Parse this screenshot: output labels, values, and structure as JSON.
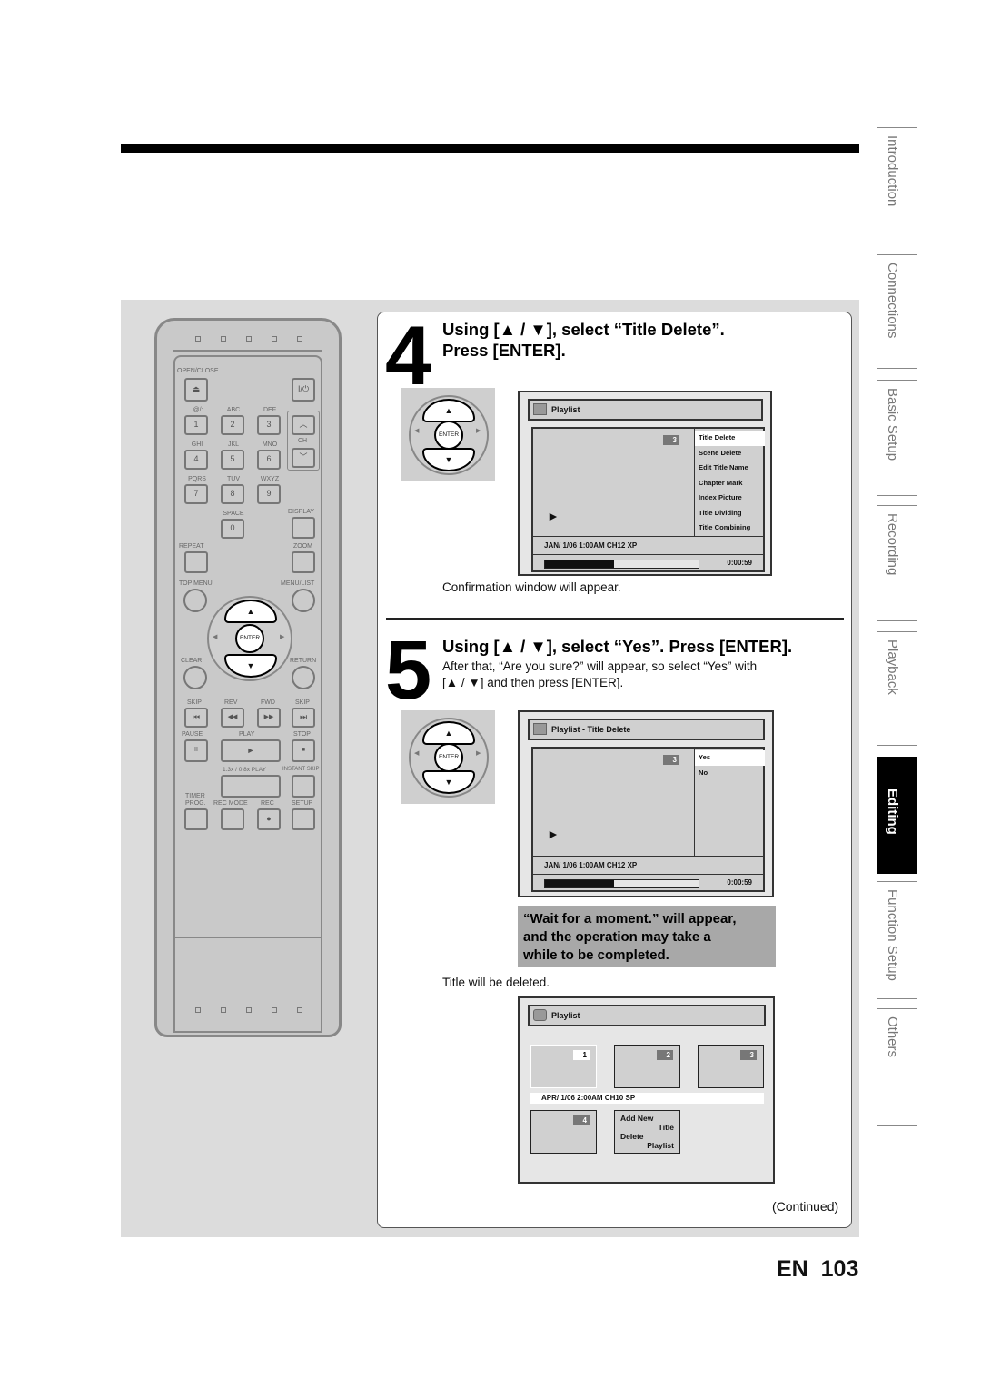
{
  "step4": {
    "number": "4",
    "heading_line1": "Using [▲ / ▼], select “Title Delete”.",
    "heading_line2": "Press [ENTER].",
    "caption": "Confirmation window will appear."
  },
  "step5": {
    "number": "5",
    "heading": "Using [▲ / ▼], select “Yes”. Press [ENTER].",
    "body_line1": "After that, “Are you sure?” will appear, so select “Yes” with",
    "body_line2": "[▲ / ▼] and then press [ENTER].",
    "note_line1": "“Wait for a moment.” will appear,",
    "note_line2": "and the operation may take a",
    "note_line3": "while to be completed.",
    "caption": "Title will be deleted."
  },
  "dpad": {
    "enter": "ENTER",
    "up": "▲",
    "down": "▼",
    "left": "◀",
    "right": "▶"
  },
  "screen1": {
    "title": "Playlist",
    "title_no": "3",
    "play_icon": "►",
    "menu": [
      "Title Delete",
      "Scene Delete",
      "Edit Title Name",
      "Chapter Mark",
      "Index Picture",
      "Title Dividing",
      "Title Combining"
    ],
    "selected": "Title Delete",
    "info": "JAN/ 1/06 1:00AM CH12 XP",
    "progress": 0.45,
    "time": "0:00:59"
  },
  "screen2": {
    "title": "Playlist - Title Delete",
    "title_no": "3",
    "play_icon": "►",
    "menu": [
      "Yes",
      "No"
    ],
    "selected": "Yes",
    "info": "JAN/ 1/06 1:00AM CH12 XP",
    "progress": 0.45,
    "time": "0:00:59"
  },
  "screen3": {
    "title": "Playlist",
    "thumbs": [
      "1",
      "2",
      "3",
      "4"
    ],
    "info": "APR/ 1/06 2:00AM CH10 SP",
    "menu_add_1": "Add New",
    "menu_add_2": "Title",
    "menu_del_1": "Delete",
    "menu_del_2": "Playlist"
  },
  "continued": "(Continued)",
  "page": {
    "lang": "EN",
    "number": "103"
  },
  "side_tabs": [
    "Introduction",
    "Connections",
    "Basic Setup",
    "Recording",
    "Playback",
    "Editing",
    "Function Setup",
    "Others"
  ],
  "active_tab": "Editing",
  "remote": {
    "open_close": "OPEN/CLOSE",
    "eject": "⏏",
    "power": "I/⏻",
    "keys": [
      {
        "letters": ".@/:",
        "num": "1"
      },
      {
        "letters": "ABC",
        "num": "2"
      },
      {
        "letters": "DEF",
        "num": "3"
      },
      {
        "letters": "GHI",
        "num": "4"
      },
      {
        "letters": "JKL",
        "num": "5"
      },
      {
        "letters": "MNO",
        "num": "6"
      },
      {
        "letters": "PQRS",
        "num": "7"
      },
      {
        "letters": "TUV",
        "num": "8"
      },
      {
        "letters": "WXYZ",
        "num": "9"
      },
      {
        "letters": "SPACE",
        "num": "0"
      }
    ],
    "ch": "CH",
    "ch_up": "︿",
    "ch_down": "﹀",
    "display": "DISPLAY",
    "repeat": "REPEAT",
    "zoom": "ZOOM",
    "top_menu": "TOP MENU",
    "menu_list": "MENU/LIST",
    "clear": "CLEAR",
    "return": "RETURN",
    "skip_back": "SKIP",
    "rev": "REV",
    "fwd": "FWD",
    "skip_fwd": "SKIP",
    "skip_back_icon": "⏮",
    "rev_icon": "◀◀",
    "fwd_icon": "▶▶",
    "skip_fwd_icon": "⏭",
    "pause": "PAUSE",
    "play": "PLAY",
    "stop": "STOP",
    "pause_icon": "II",
    "play_icon": "►",
    "stop_icon": "■",
    "speed_play": "1.3x / 0.8x PLAY",
    "instant_skip": "INSTANT SKIP",
    "timer_prog_1": "TIMER",
    "timer_prog_2": "PROG.",
    "rec_mode": "REC MODE",
    "rec": "REC",
    "setup": "SETUP",
    "rec_icon": "●"
  }
}
